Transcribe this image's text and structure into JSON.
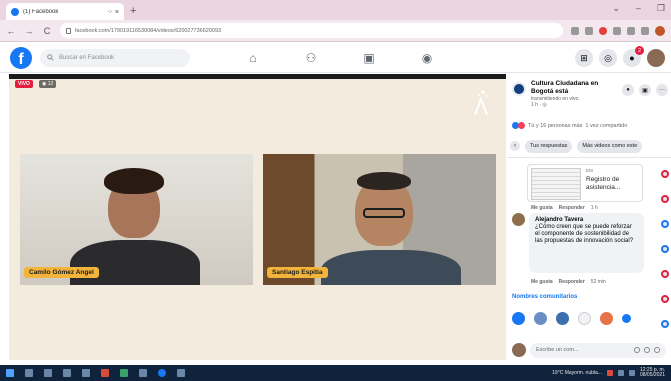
{
  "browser": {
    "tab_title": "(1) Facebook",
    "tab_controls": "⁘ ×",
    "new_tab": "+",
    "window_controls": [
      "⌄",
      "–",
      "❐"
    ],
    "nav": [
      "←",
      "→",
      "C"
    ],
    "url": "facebook.com/179019116530084/videos/620027736620093"
  },
  "facebook": {
    "logo": "f",
    "search_placeholder": "Buscar en Facebook",
    "nav_icons": [
      "home-icon",
      "friends-icon",
      "watch-icon",
      "groups-icon"
    ],
    "nav_glyphs": [
      "⌂",
      "⚇",
      "▣",
      "◉"
    ],
    "right_icons": [
      "⊞",
      "◎",
      "●",
      ""
    ],
    "notification_count": "2",
    "brand_color": "#1877f2"
  },
  "video": {
    "live_label": "VIVO",
    "viewer_count": "◉ 12",
    "participants": [
      "Camilo Gómez Angel",
      "Santiago Espitia"
    ],
    "name_tag_color": "#f3b43b"
  },
  "sidebar": {
    "page_name": "Cultura Ciudadana en Bogotá está",
    "page_status": "transmitiendo en vivo.",
    "page_meta": "1 h · ◎",
    "header_buttons": [
      "●",
      "▣",
      "···"
    ],
    "reactions_text": "Tú y 16 personas más",
    "shares_text": "1 vez compartido",
    "chips": [
      "Tus respuestas",
      "Más videos como este"
    ],
    "chip_arrow": "‹",
    "shared_card": {
      "small": "EM",
      "title": "Registro de asistencia..."
    },
    "actions_1": [
      "Me gusta",
      "Responder",
      "1 h"
    ],
    "comment": {
      "author": "Alejandro Tavera",
      "text": "¿Cómo creen que se puede reforzar el componente de sostenibilidad de las propuestas de innovación social?"
    },
    "actions_2": [
      "Me gusta",
      "Responder",
      "52 min"
    ],
    "more_comments": "Nombres comunitarios",
    "compose_placeholder": "Escribe un com..."
  },
  "taskbar": {
    "weather": "19°C Mayorm. nubla...",
    "time": "12:25 p. m.",
    "date": "08/05/2021"
  }
}
